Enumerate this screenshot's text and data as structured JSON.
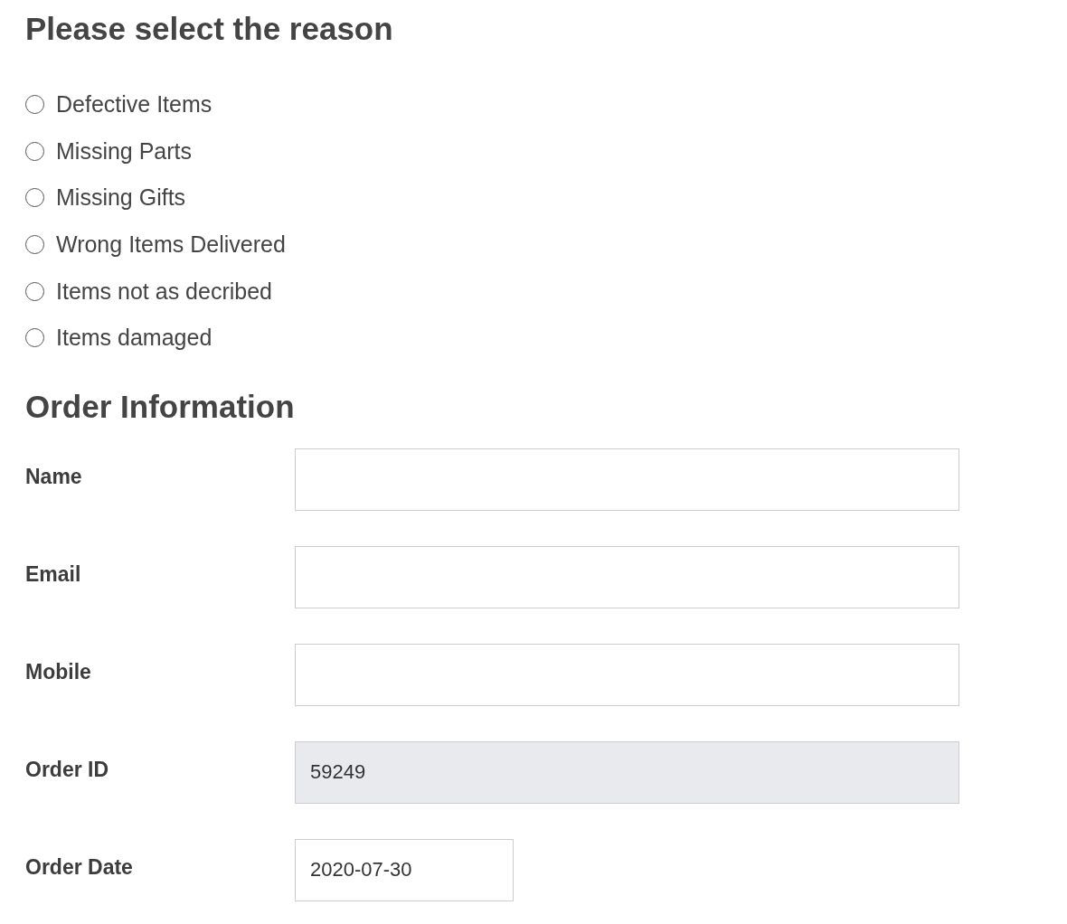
{
  "reason_section": {
    "title": "Please select the reason",
    "reasons": [
      {
        "label": "Defective Items",
        "selected": false
      },
      {
        "label": "Missing Parts",
        "selected": false
      },
      {
        "label": "Missing Gifts",
        "selected": false
      },
      {
        "label": "Wrong Items Delivered",
        "selected": false
      },
      {
        "label": "Items not as decribed",
        "selected": false
      },
      {
        "label": "Items damaged",
        "selected": false
      }
    ]
  },
  "order_section": {
    "title": "Order Information",
    "fields": [
      {
        "label": "Name",
        "kind": "text",
        "disabled": false
      },
      {
        "label": "Email",
        "kind": "text",
        "disabled": false
      },
      {
        "label": "Mobile",
        "kind": "text",
        "disabled": false
      },
      {
        "label": "Order ID",
        "kind": "text",
        "value": "59249",
        "disabled": true
      },
      {
        "label": "Order Date",
        "kind": "date",
        "value": "2020-07-30",
        "disabled": false
      }
    ]
  }
}
